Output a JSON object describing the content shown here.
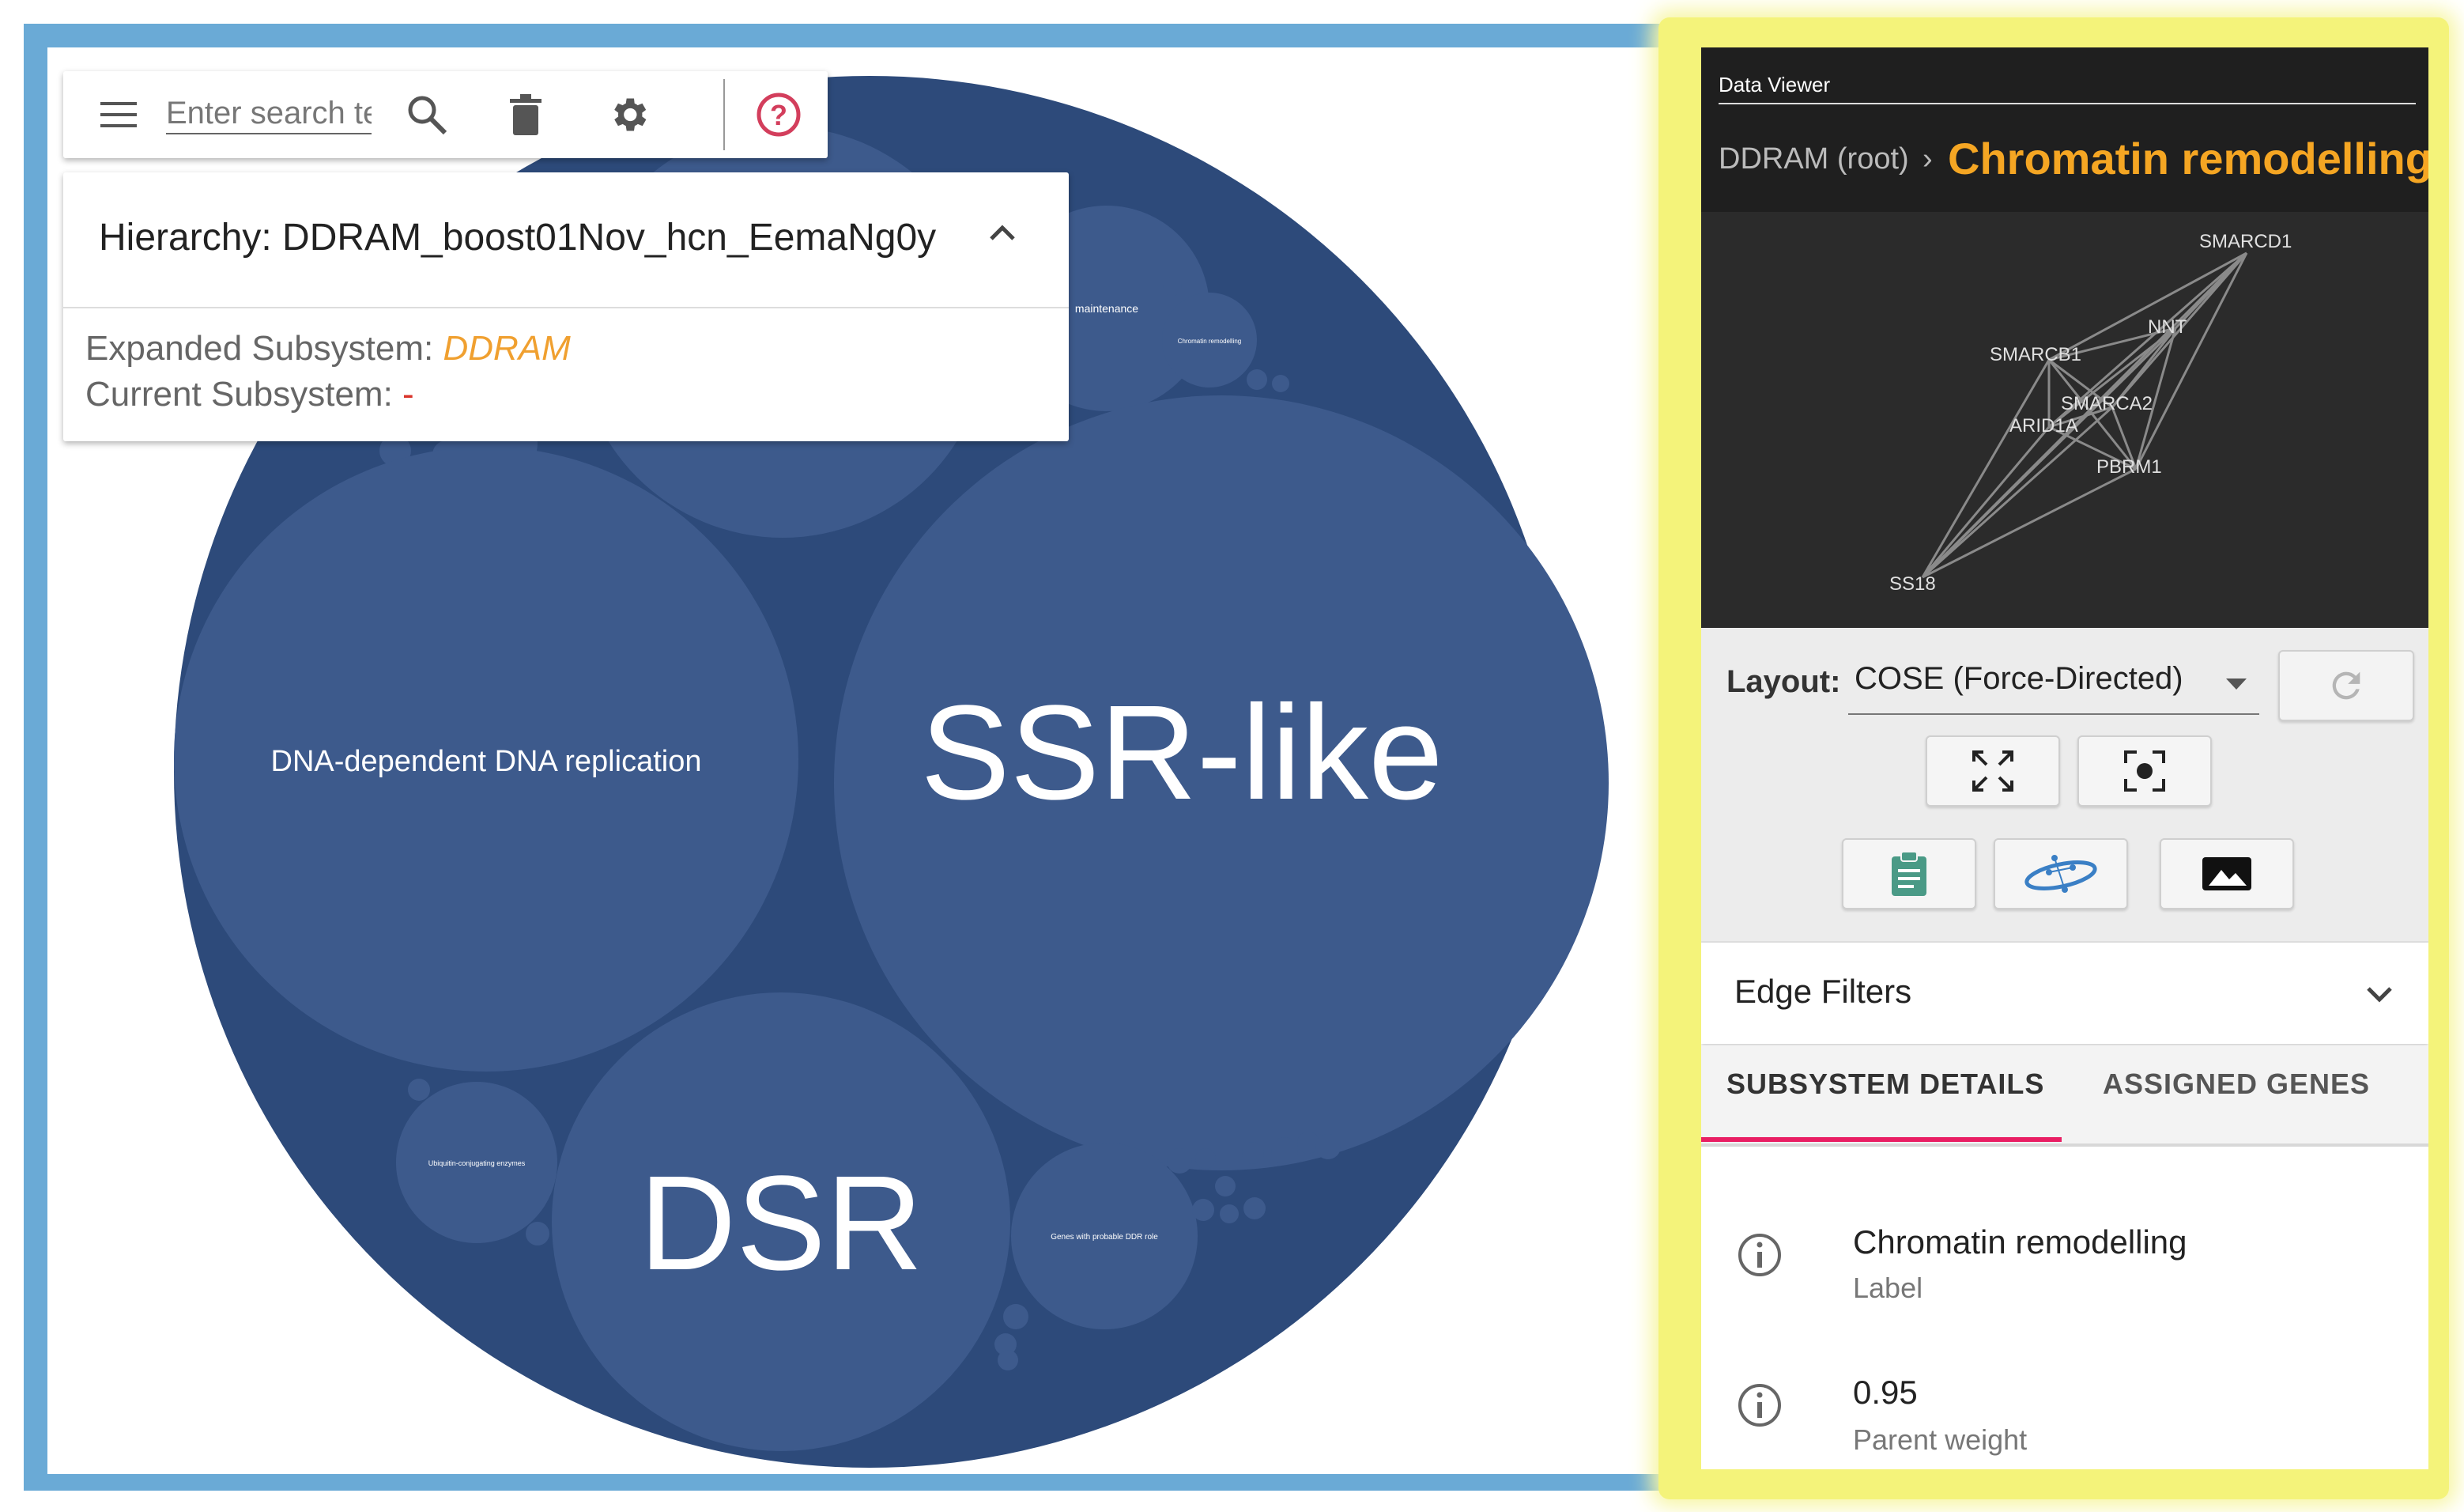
{
  "toolbar": {
    "menu_icon": "menu-icon",
    "search_placeholder": "Enter search terms",
    "search_icon": "search-icon",
    "delete_icon": "trash-icon",
    "settings_icon": "gear-icon",
    "help_icon": "help-circle-icon"
  },
  "hierarchy": {
    "title": "Hierarchy: DDRAM_boost01Nov_hcn_EemaNg0y",
    "expanded_label": "Expanded Subsystem: ",
    "expanded_value": "DDRAM",
    "current_label": "Current Subsystem: ",
    "current_value": "-"
  },
  "circles": {
    "dna_replication": "DNA-dependent DNA replication",
    "ssr_like": "SSR-like",
    "dsr": "DSR",
    "maintenance": "maintenance",
    "chromatin_small": "Chromatin remodelling",
    "ubiquitin": "Ubiquitin-conjugating enzymes",
    "genes_ddr": "Genes with probable DDR role"
  },
  "viewer": {
    "header_label": "Data Viewer",
    "breadcrumb_root": "DDRAM (root)",
    "breadcrumb_sep": "›",
    "breadcrumb_current": "Chromatin remodelling",
    "network_nodes": [
      "SMARCD1",
      "NNT",
      "SMARCB1",
      "SMARCA2",
      "ARID1A",
      "PBRM1",
      "SS18"
    ],
    "layout_label": "Layout:",
    "layout_value": "COSE (Force-Directed)",
    "edge_filters": "Edge Filters",
    "tabs": [
      "SUBSYSTEM DETAILS",
      "ASSIGNED GENES"
    ],
    "details": [
      {
        "value": "Chromatin remodelling",
        "caption": "Label"
      },
      {
        "value": "0.95",
        "caption": "Parent weight"
      }
    ],
    "colors": {
      "accent": "#f5a623",
      "tab_indicator": "#e91e63",
      "circle_outer": "#2d4a7a",
      "circle_inner": "#3d5a8c"
    }
  }
}
